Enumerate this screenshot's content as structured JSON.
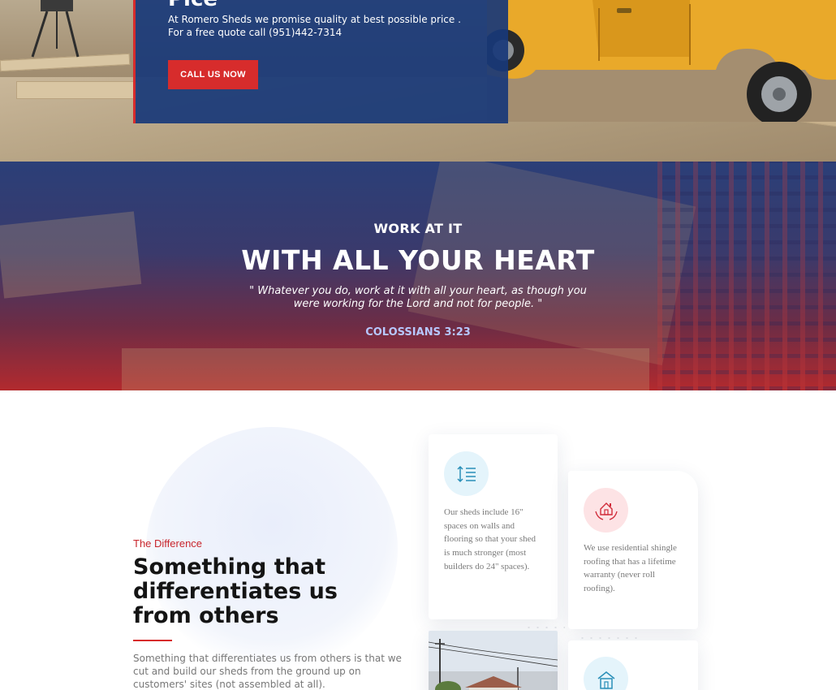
{
  "hero": {
    "title_partial": "Pice",
    "text": "At Romero Sheds we promise quality at best possible price . For a free quote call (951)442-7314",
    "cta_label": "CALL US NOW",
    "accent_color": "#d72c2c",
    "panel_color": "#183878"
  },
  "quote": {
    "eyebrow": "WORK AT IT",
    "heading": "WITH ALL YOUR HEART",
    "text": "\" Whatever you do, work at it with all your heart, as though you were working for the Lord and not for people. \"",
    "reference": "COLOSSIANS 3:23"
  },
  "difference": {
    "eyebrow": "The Difference",
    "title": "Something that differentiates us from others",
    "text": "Something that differentiates us from others is that we cut and build our sheds from the ground up on customers' sites (not assembled at all).",
    "cards": [
      {
        "icon": "line-spacing-icon",
        "text": "Our sheds include 16\" spaces on walls and flooring so that your shed is much stronger (most builders do 24\" spaces)."
      },
      {
        "icon": "house-in-hands-icon",
        "text": "We use residential shingle roofing that has a lifetime warranty (never roll roofing)."
      },
      {
        "icon": "house-icon",
        "text": ""
      }
    ]
  }
}
